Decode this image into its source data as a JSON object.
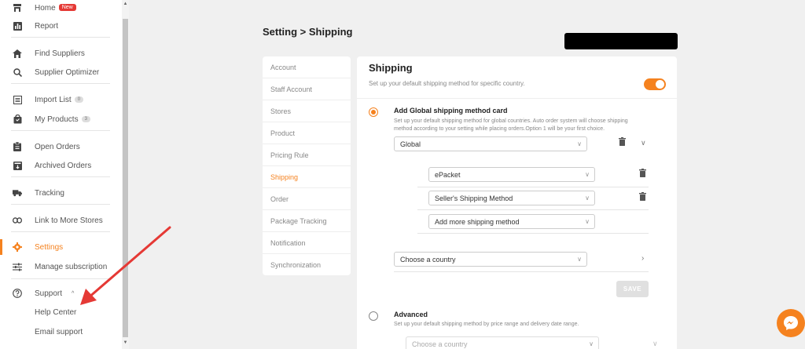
{
  "sidebar": {
    "items": [
      {
        "label": "Home",
        "badge": "New",
        "icon": "store-icon"
      },
      {
        "label": "Report",
        "icon": "chart-icon"
      },
      {
        "label": "Find Suppliers",
        "icon": "home-icon"
      },
      {
        "label": "Supplier Optimizer",
        "icon": "search-icon"
      },
      {
        "label": "Import List",
        "badge": "0",
        "icon": "list-icon"
      },
      {
        "label": "My Products",
        "badge": "3",
        "icon": "bag-icon"
      },
      {
        "label": "Open Orders",
        "icon": "clipboard-icon"
      },
      {
        "label": "Archived Orders",
        "icon": "archive-icon"
      },
      {
        "label": "Tracking",
        "icon": "truck-icon"
      },
      {
        "label": "Link to More Stores",
        "icon": "link-icon"
      },
      {
        "label": "Settings",
        "icon": "gear-icon"
      },
      {
        "label": "Manage subscription",
        "icon": "sliders-icon"
      },
      {
        "label": "Support",
        "icon": "help-icon"
      },
      {
        "label": "Help Center"
      },
      {
        "label": "Email support"
      }
    ],
    "active": "Settings"
  },
  "header": {
    "title": "Setting > Shipping"
  },
  "settings_nav": {
    "items": [
      "Account",
      "Staff Account",
      "Stores",
      "Product",
      "Pricing Rule",
      "Shipping",
      "Order",
      "Package Tracking",
      "Notification",
      "Synchronization"
    ],
    "active": "Shipping"
  },
  "shipping": {
    "title": "Shipping",
    "subtitle": "Set up your default shipping method for specific country.",
    "toggle_on": true,
    "global_card": {
      "title": "Add Global shipping method card",
      "desc_line1": "Set up your default shipping method for global countries. Auto order system will choose shipping",
      "desc_line2": "method according to your setting while placing orders.Option 1 will be your first choice.",
      "country_select": "Global",
      "methods": [
        "ePacket",
        "Seller's Shipping Method"
      ],
      "add_more": "Add more shipping method",
      "choose_country": "Choose a country"
    },
    "save_label": "SAVE",
    "advanced": {
      "title": "Advanced",
      "desc": "Set up your default shipping method by price range and delivery date range.",
      "choose_country": "Choose a country"
    }
  },
  "colors": {
    "accent": "#f5821f",
    "annotation_arrow": "#e53935"
  }
}
